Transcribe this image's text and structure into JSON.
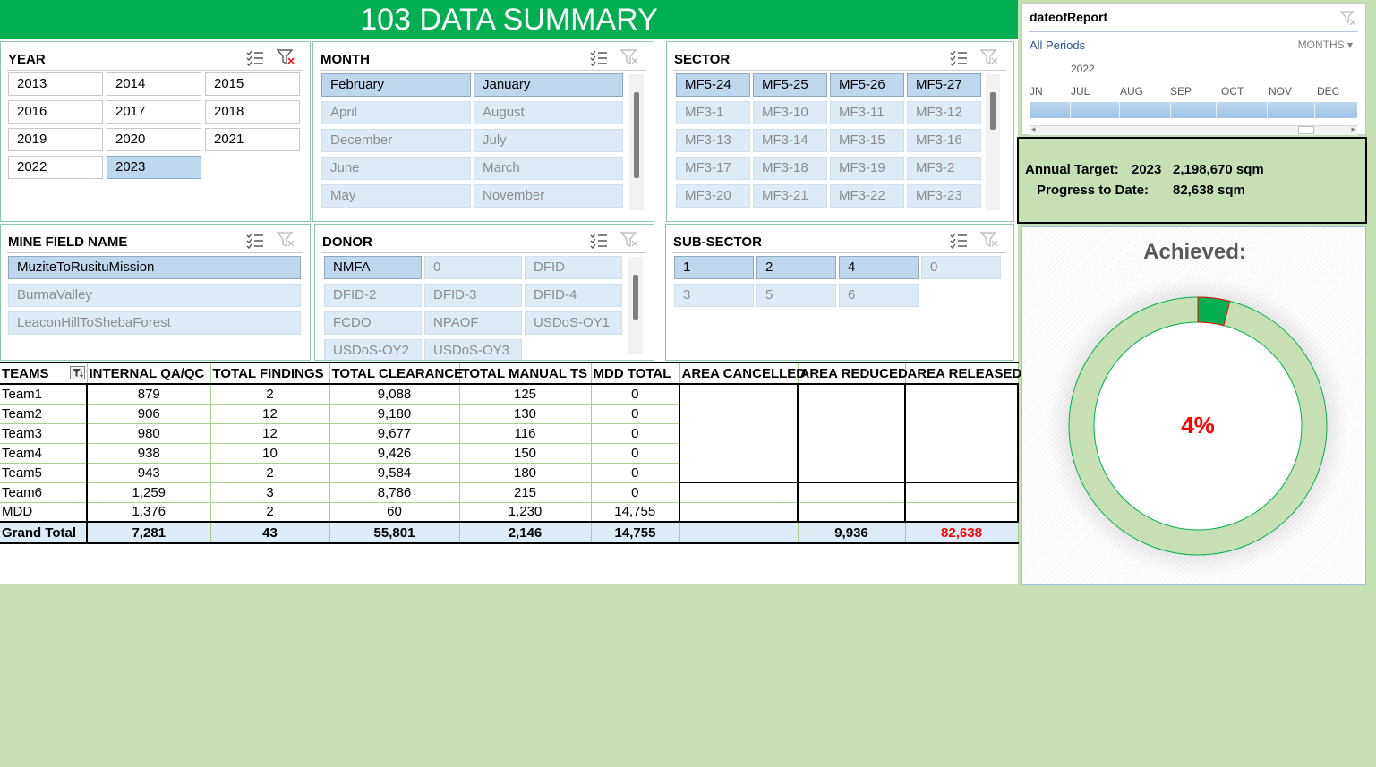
{
  "title": "103 DATA SUMMARY",
  "colors": {
    "accent": "#00b050",
    "background": "#c6e0b4",
    "selected": "#bdd7ee",
    "nodata": "#ddebf7",
    "achieved_text": "#ff0000"
  },
  "slicers": {
    "year": {
      "title": "YEAR",
      "items": [
        {
          "label": "2013",
          "state": "plain"
        },
        {
          "label": "2014",
          "state": "plain"
        },
        {
          "label": "2015",
          "state": "plain"
        },
        {
          "label": "2016",
          "state": "plain"
        },
        {
          "label": "2017",
          "state": "plain"
        },
        {
          "label": "2018",
          "state": "plain"
        },
        {
          "label": "2019",
          "state": "plain"
        },
        {
          "label": "2020",
          "state": "plain"
        },
        {
          "label": "2021",
          "state": "plain"
        },
        {
          "label": "2022",
          "state": "plain"
        },
        {
          "label": "2023",
          "state": "sel"
        }
      ]
    },
    "month": {
      "title": "MONTH",
      "items": [
        {
          "label": "February",
          "state": "sel"
        },
        {
          "label": "January",
          "state": "sel"
        },
        {
          "label": "April",
          "state": "nodata"
        },
        {
          "label": "August",
          "state": "nodata"
        },
        {
          "label": "December",
          "state": "nodata"
        },
        {
          "label": "July",
          "state": "nodata"
        },
        {
          "label": "June",
          "state": "nodata"
        },
        {
          "label": "March",
          "state": "nodata"
        },
        {
          "label": "May",
          "state": "nodata"
        },
        {
          "label": "November",
          "state": "nodata"
        }
      ]
    },
    "sector": {
      "title": "SECTOR",
      "items": [
        {
          "label": "MF5-24",
          "state": "sel"
        },
        {
          "label": "MF5-25",
          "state": "sel"
        },
        {
          "label": "MF5-26",
          "state": "sel"
        },
        {
          "label": "MF5-27",
          "state": "sel"
        },
        {
          "label": "MF3-1",
          "state": "nodata"
        },
        {
          "label": "MF3-10",
          "state": "nodata"
        },
        {
          "label": "MF3-11",
          "state": "nodata"
        },
        {
          "label": "MF3-12",
          "state": "nodata"
        },
        {
          "label": "MF3-13",
          "state": "nodata"
        },
        {
          "label": "MF3-14",
          "state": "nodata"
        },
        {
          "label": "MF3-15",
          "state": "nodata"
        },
        {
          "label": "MF3-16",
          "state": "nodata"
        },
        {
          "label": "MF3-17",
          "state": "nodata"
        },
        {
          "label": "MF3-18",
          "state": "nodata"
        },
        {
          "label": "MF3-19",
          "state": "nodata"
        },
        {
          "label": "MF3-2",
          "state": "nodata"
        },
        {
          "label": "MF3-20",
          "state": "nodata"
        },
        {
          "label": "MF3-21",
          "state": "nodata"
        },
        {
          "label": "MF3-22",
          "state": "nodata"
        },
        {
          "label": "MF3-23",
          "state": "nodata"
        }
      ]
    },
    "minefield": {
      "title": "MINE FIELD NAME",
      "items": [
        {
          "label": "MuziteToRusituMission",
          "state": "sel"
        },
        {
          "label": "BurmaValley",
          "state": "nodata"
        },
        {
          "label": "LeaconHillToShebaForest",
          "state": "nodata"
        }
      ]
    },
    "donor": {
      "title": "DONOR",
      "items": [
        {
          "label": "NMFA",
          "state": "sel"
        },
        {
          "label": "0",
          "state": "nodata"
        },
        {
          "label": "DFID",
          "state": "nodata"
        },
        {
          "label": "DFID-2",
          "state": "nodata"
        },
        {
          "label": "DFID-3",
          "state": "nodata"
        },
        {
          "label": "DFID-4",
          "state": "nodata"
        },
        {
          "label": "FCDO",
          "state": "nodata"
        },
        {
          "label": "NPAOF",
          "state": "nodata"
        },
        {
          "label": "USDoS-OY1",
          "state": "nodata"
        },
        {
          "label": "USDoS-OY2",
          "state": "nodata"
        },
        {
          "label": "USDoS-OY3",
          "state": "nodata"
        }
      ]
    },
    "subsector": {
      "title": "SUB-SECTOR",
      "items": [
        {
          "label": "1",
          "state": "sel"
        },
        {
          "label": "2",
          "state": "sel"
        },
        {
          "label": "4",
          "state": "sel"
        },
        {
          "label": "0",
          "state": "nodata"
        },
        {
          "label": "3",
          "state": "nodata"
        },
        {
          "label": "5",
          "state": "nodata"
        },
        {
          "label": "6",
          "state": "nodata"
        }
      ]
    }
  },
  "timeline": {
    "title": "dateofReport",
    "all_periods": "All Periods",
    "level": "MONTHS",
    "year": "2022",
    "months": [
      "JN",
      "JUL",
      "AUG",
      "SEP",
      "OCT",
      "NOV",
      "DEC"
    ]
  },
  "target": {
    "annual_label": "Annual Target:",
    "year": "2023",
    "annual_value": "2,198,670 sqm",
    "progress_label": "Progress to Date:",
    "progress_value": "82,638 sqm"
  },
  "achieved": {
    "title": "Achieved:",
    "percent_text": "4%",
    "fraction": 0.04
  },
  "table": {
    "headers": [
      "TEAMS",
      "INTERNAL QA/QC",
      "TOTAL FINDINGS",
      "TOTAL CLEARANCE",
      "TOTAL MANUAL TS",
      "MDD TOTAL",
      "AREA CANCELLED",
      "AREA REDUCED",
      "AREA RELEASED"
    ],
    "rows": [
      [
        "Team1",
        "879",
        "2",
        "9,088",
        "125",
        "0",
        "",
        "",
        ""
      ],
      [
        "Team2",
        "906",
        "12",
        "9,180",
        "130",
        "0",
        "",
        "",
        ""
      ],
      [
        "Team3",
        "980",
        "12",
        "9,677",
        "116",
        "0",
        "",
        "",
        ""
      ],
      [
        "Team4",
        "938",
        "10",
        "9,426",
        "150",
        "0",
        "",
        "",
        ""
      ],
      [
        "Team5",
        "943",
        "2",
        "9,584",
        "180",
        "0",
        "",
        "",
        ""
      ],
      [
        "Team6",
        "1,259",
        "3",
        "8,786",
        "215",
        "0",
        "",
        "",
        ""
      ],
      [
        "MDD",
        "1,376",
        "2",
        "60",
        "1,230",
        "14,755",
        "",
        "",
        ""
      ]
    ],
    "total": [
      "Grand Total",
      "7,281",
      "43",
      "55,801",
      "2,146",
      "14,755",
      "",
      "9,936",
      "82,638"
    ]
  }
}
